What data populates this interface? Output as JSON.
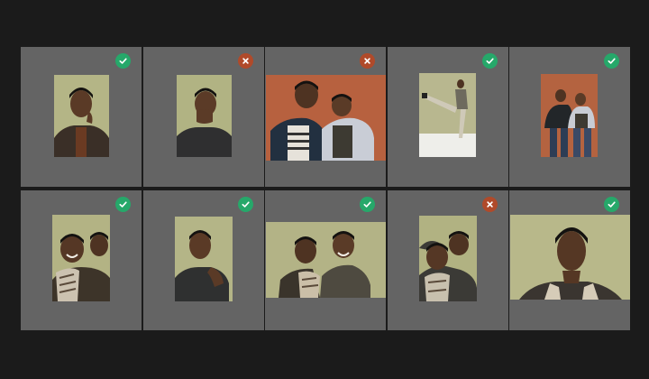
{
  "colors": {
    "background": "#1b1b1b",
    "tile": "#646464",
    "approved": "#26a86a",
    "rejected": "#b04a2a"
  },
  "photos": [
    {
      "status": "approved",
      "icon": "check-icon",
      "backdrop": "#b4b586",
      "subject": "single"
    },
    {
      "status": "rejected",
      "icon": "close-icon",
      "backdrop": "#b1b383",
      "subject": "single"
    },
    {
      "status": "rejected",
      "icon": "close-icon",
      "backdrop": "#b7613f",
      "subject": "pair"
    },
    {
      "status": "approved",
      "icon": "check-icon",
      "backdrop": "#b8b78f",
      "subject": "single"
    },
    {
      "status": "approved",
      "icon": "check-icon",
      "backdrop": "#b46340",
      "subject": "pair"
    },
    {
      "status": "approved",
      "icon": "check-icon",
      "backdrop": "#b3b384",
      "subject": "pair"
    },
    {
      "status": "approved",
      "icon": "check-icon",
      "backdrop": "#b4b587",
      "subject": "single"
    },
    {
      "status": "approved",
      "icon": "check-icon",
      "backdrop": "#b3b386",
      "subject": "pair"
    },
    {
      "status": "rejected",
      "icon": "close-icon",
      "backdrop": "#b1b282",
      "subject": "pair"
    },
    {
      "status": "approved",
      "icon": "check-icon",
      "backdrop": "#b8b88a",
      "subject": "single"
    }
  ]
}
